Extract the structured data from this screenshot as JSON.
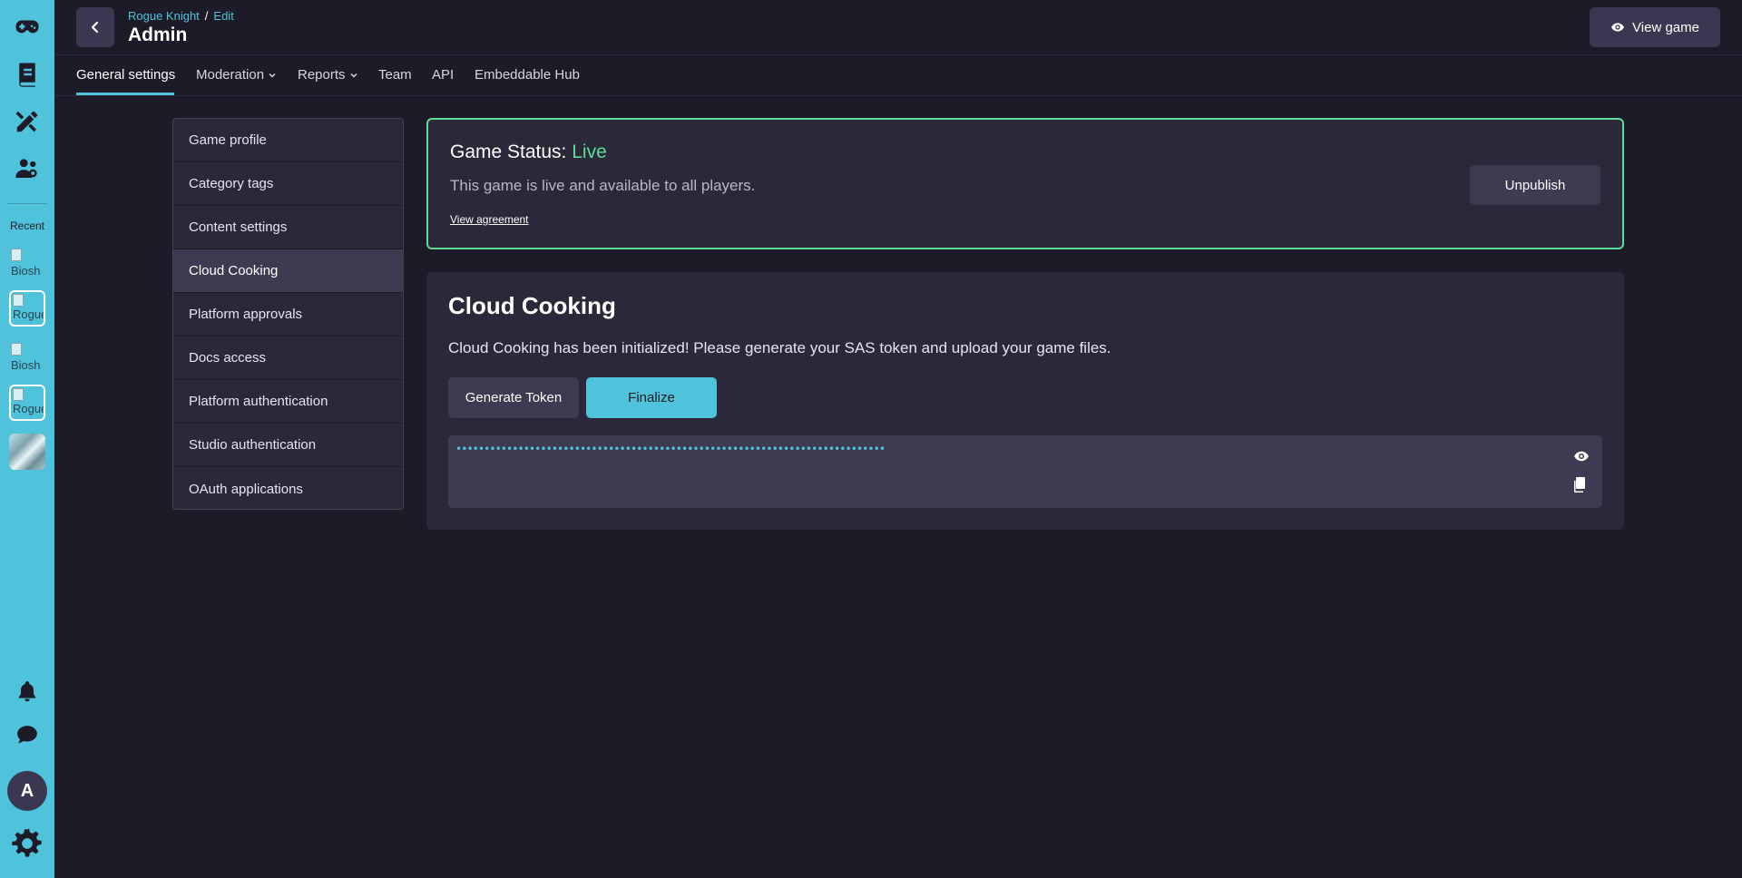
{
  "rail": {
    "recent_label": "Recent",
    "recent_items": [
      {
        "alt": "Biosh"
      },
      {
        "alt": "Rogue"
      },
      {
        "alt": "Biosh"
      },
      {
        "alt": "Rogue"
      }
    ],
    "avatar_initial": "A"
  },
  "header": {
    "breadcrumb": {
      "game": "Rogue Knight",
      "separator": "/",
      "current": "Edit"
    },
    "title": "Admin",
    "view_game_label": "View game"
  },
  "tabs": [
    {
      "label": "General settings"
    },
    {
      "label": "Moderation"
    },
    {
      "label": "Reports"
    },
    {
      "label": "Team"
    },
    {
      "label": "API"
    },
    {
      "label": "Embeddable Hub"
    }
  ],
  "side_menu": [
    {
      "label": "Game profile"
    },
    {
      "label": "Category tags"
    },
    {
      "label": "Content settings"
    },
    {
      "label": "Cloud Cooking"
    },
    {
      "label": "Platform approvals"
    },
    {
      "label": "Docs access"
    },
    {
      "label": "Platform authentication"
    },
    {
      "label": "Studio authentication"
    },
    {
      "label": "OAuth applications"
    }
  ],
  "status": {
    "title_prefix": "Game Status: ",
    "value": "Live",
    "description": "This game is live and available to all players.",
    "agreement_link": "View agreement",
    "unpublish_label": "Unpublish"
  },
  "cloud_cooking": {
    "title": "Cloud Cooking",
    "description": "Cloud Cooking has been initialized! Please generate your SAS token and upload your game files.",
    "generate_label": "Generate Token",
    "finalize_label": "Finalize",
    "token_masked": "••••••••••••••••••••••••••••••••••••••••••••••••••••••••••••••••••••••••••••"
  },
  "colors": {
    "accent": "#4ec3db",
    "live": "#5ddc9a",
    "background": "#1d1b27",
    "card": "#2b2939"
  }
}
